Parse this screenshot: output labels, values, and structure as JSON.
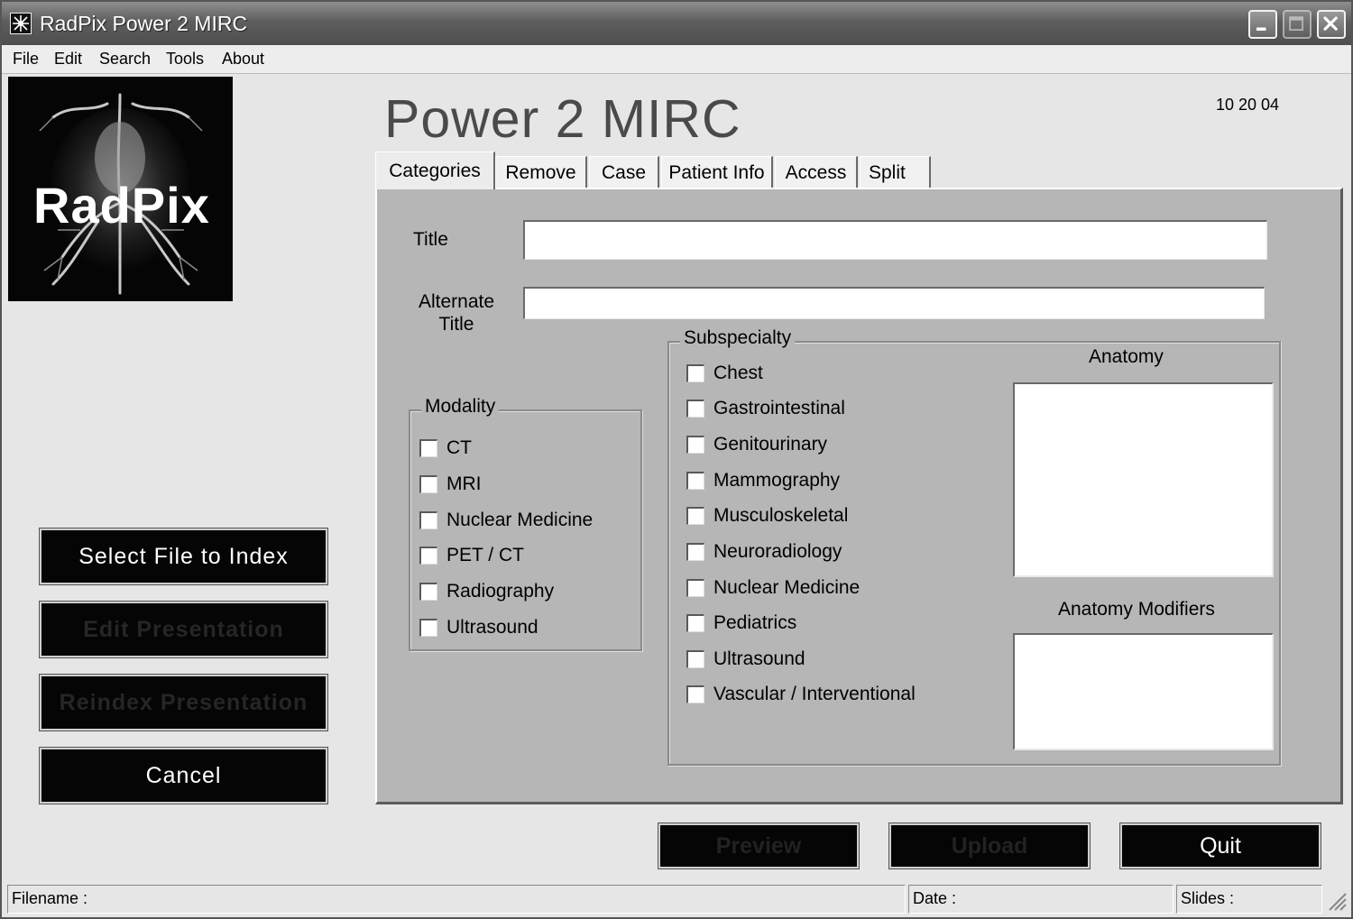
{
  "window": {
    "title": "RadPix Power 2 MIRC"
  },
  "menu": {
    "items": [
      "File",
      "Edit",
      "Search",
      "Tools",
      "About"
    ]
  },
  "logo": {
    "text": "RadPix"
  },
  "header": {
    "app_title": "Power 2 MIRC",
    "date_code": "10 20 04"
  },
  "left_buttons": {
    "select_file": "Select File to Index",
    "edit_presentation": "Edit Presentation",
    "reindex_presentation": "Reindex Presentation",
    "cancel": "Cancel"
  },
  "tabs": [
    "Categories",
    "Remove",
    "Case",
    "Patient Info",
    "Access",
    "Split"
  ],
  "active_tab": "Categories",
  "form": {
    "title_label": "Title",
    "title_value": "",
    "alternate_title_label_line1": "Alternate",
    "alternate_title_label_line2": "Title",
    "alternate_title_value": ""
  },
  "modality": {
    "label": "Modality",
    "items": [
      "CT",
      "MRI",
      "Nuclear Medicine",
      "PET / CT",
      "Radiography",
      "Ultrasound"
    ]
  },
  "subspecialty": {
    "label": "Subspecialty",
    "items": [
      "Chest",
      "Gastrointestinal",
      "Genitourinary",
      "Mammography",
      "Musculoskeletal",
      "Neuroradiology",
      "Nuclear Medicine",
      "Pediatrics",
      "Ultrasound",
      "Vascular / Interventional"
    ]
  },
  "anatomy": {
    "label": "Anatomy",
    "modifiers_label": "Anatomy Modifiers"
  },
  "bottom_buttons": {
    "preview": "Preview",
    "upload": "Upload",
    "quit": "Quit"
  },
  "status": {
    "filename_label": "Filename :",
    "date_label": "Date :",
    "slides_label": "Slides :"
  }
}
